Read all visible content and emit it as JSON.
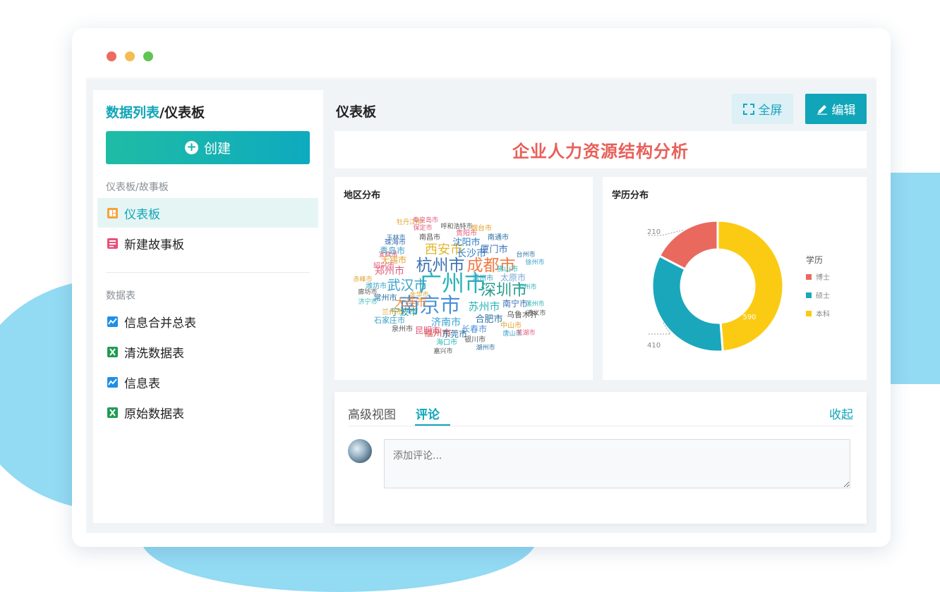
{
  "window": {
    "dots": [
      "#ee6a5e",
      "#f5bd4f",
      "#61c554"
    ]
  },
  "sidebar": {
    "breadcrumb_link": "数据列表",
    "breadcrumb_current": "/仪表板",
    "create_label": "创建",
    "section_dash": "仪表板/故事板",
    "dash_items": [
      {
        "label": "仪表板",
        "icon": "dashboard-icon",
        "color": "#f4a33a"
      },
      {
        "label": "新建故事板",
        "icon": "storyboard-icon",
        "color": "#e8507a"
      }
    ],
    "section_tables": "数据表",
    "table_items": [
      {
        "label": "信息合并总表",
        "icon": "line-chart-icon",
        "color": "#1f8fe6"
      },
      {
        "label": "清洗数据表",
        "icon": "excel-icon",
        "color": "#1f9b55"
      },
      {
        "label": "信息表",
        "icon": "line-chart-icon",
        "color": "#1f8fe6"
      },
      {
        "label": "原始数据表",
        "icon": "excel-icon",
        "color": "#1f9b55"
      }
    ]
  },
  "main": {
    "title": "仪表板",
    "fullscreen_label": "全屏",
    "edit_label": "编辑",
    "banner_title": "企业人力资源结构分析",
    "region_card_title": "地区分布",
    "edu_card_title": "学历分布"
  },
  "wordcloud": [
    {
      "t": "广州市",
      "c": "#2bb4b8"
    },
    {
      "t": "南京市",
      "c": "#4a90d9"
    },
    {
      "t": "杭州市",
      "c": "#3a6fb0"
    },
    {
      "t": "成都市",
      "c": "#ef7b45"
    },
    {
      "t": "深圳市",
      "c": "#2a9d8f"
    },
    {
      "t": "武汉市",
      "c": "#37a0c8"
    },
    {
      "t": "西安市",
      "c": "#e3b62b"
    },
    {
      "t": "大连市",
      "c": "#f08a3c"
    },
    {
      "t": "苏州市",
      "c": "#2bb4b8"
    },
    {
      "t": "长沙市",
      "c": "#2f7ec7"
    },
    {
      "t": "郑州市",
      "c": "#e05a7a"
    },
    {
      "t": "济南市",
      "c": "#3aa0d5"
    },
    {
      "t": "福州市",
      "c": "#d9534f"
    },
    {
      "t": "合肥市",
      "c": "#2a6f9e"
    },
    {
      "t": "宁波市",
      "c": "#2a9d8f"
    },
    {
      "t": "沈阳市",
      "c": "#2f7ec7"
    },
    {
      "t": "厦门市",
      "c": "#3b6fb6"
    },
    {
      "t": "太原市",
      "c": "#7aa5d9"
    },
    {
      "t": "青岛市",
      "c": "#37a0c8"
    },
    {
      "t": "无锡市",
      "c": "#e3a12b"
    },
    {
      "t": "长春市",
      "c": "#4a90d9"
    },
    {
      "t": "东莞市",
      "c": "#2a6f9e"
    },
    {
      "t": "昆明市",
      "c": "#e05a7a"
    },
    {
      "t": "南宁市",
      "c": "#3b6fb6"
    },
    {
      "t": "乌鲁木齐",
      "c": "#555"
    },
    {
      "t": "石家庄市",
      "c": "#37a0c8"
    },
    {
      "t": "常州市",
      "c": "#2a6f9e"
    },
    {
      "t": "兰州市",
      "c": "#e3a12b"
    },
    {
      "t": "泉州市",
      "c": "#555"
    },
    {
      "t": "海口市",
      "c": "#2bb4b8"
    },
    {
      "t": "南昌市",
      "c": "#555"
    },
    {
      "t": "珠海市",
      "c": "#3b6fb6"
    },
    {
      "t": "贵阳市",
      "c": "#e05a7a"
    },
    {
      "t": "南通市",
      "c": "#2a6f9e"
    },
    {
      "t": "中山市",
      "c": "#e3a12b"
    },
    {
      "t": "银川市",
      "c": "#555"
    },
    {
      "t": "温州市",
      "c": "#37a0c8"
    },
    {
      "t": "绍兴市",
      "c": "#e05a7a"
    },
    {
      "t": "佛山市",
      "c": "#2bb4b8"
    },
    {
      "t": "烟台市",
      "c": "#e3a12b"
    },
    {
      "t": "保定市",
      "c": "#e05a7a"
    },
    {
      "t": "嘉兴市",
      "c": "#555"
    },
    {
      "t": "湖州市",
      "c": "#2a6f9e"
    },
    {
      "t": "潍坊市",
      "c": "#37a0c8"
    },
    {
      "t": "赤峰市",
      "c": "#e3a12b"
    },
    {
      "t": "泸州市",
      "c": "#2bb4b8"
    },
    {
      "t": "呼和浩特市",
      "c": "#555"
    },
    {
      "t": "秦皇岛市",
      "c": "#e05a7a"
    },
    {
      "t": "牡丹江市",
      "c": "#e3a12b"
    },
    {
      "t": "玉林市",
      "c": "#2a6f9e"
    },
    {
      "t": "唐山市",
      "c": "#37a0c8"
    },
    {
      "t": "芜湖市",
      "c": "#e05a7a"
    },
    {
      "t": "漯州市",
      "c": "#2bb4b8"
    },
    {
      "t": "遵义市",
      "c": "#555"
    },
    {
      "t": "金华市",
      "c": "#e3a12b"
    },
    {
      "t": "徐州市",
      "c": "#37a0c8"
    },
    {
      "t": "台州市",
      "c": "#2a6f9e"
    },
    {
      "t": "宜宾市",
      "c": "#e05a7a"
    },
    {
      "t": "济宁市",
      "c": "#2bb4b8"
    },
    {
      "t": "廊坊市",
      "c": "#555"
    }
  ],
  "chart_data": {
    "type": "pie",
    "title": "学历分布",
    "legend_title": "学历",
    "legend_position": "right",
    "categories": [
      "博士",
      "硕士",
      "本科"
    ],
    "values": [
      210,
      410,
      590
    ],
    "colors": [
      "#e9695f",
      "#1aa7bc",
      "#fbcb13"
    ],
    "data_labels": [
      "210",
      "410",
      "590"
    ]
  },
  "comments": {
    "tab_advanced": "高级视图",
    "tab_comments": "评论",
    "collapse_label": "收起",
    "input_placeholder": "添加评论..."
  }
}
